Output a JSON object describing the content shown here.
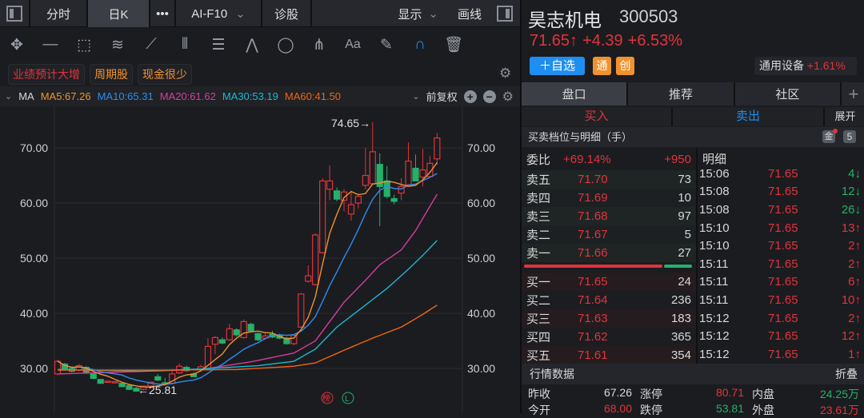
{
  "toolbar": {
    "tabs": [
      "分时",
      "日K",
      "•••",
      "AI-F10",
      "诊股"
    ],
    "display": "显示",
    "draw": "画线",
    "tools": [
      "move-icon",
      "line-icon",
      "rectangle-icon",
      "fan-icon",
      "segment-icon",
      "parallel-lines-icon",
      "fibonacci-icon",
      "wave-icon",
      "circle-icon",
      "pitchfork-icon",
      "text-icon",
      "eraser-icon",
      "magnet-icon",
      "trash-icon"
    ],
    "text_tool": "Aa"
  },
  "tags": [
    {
      "label": "业绩预计大增",
      "color": "#e0343b"
    },
    {
      "label": "周期股",
      "color": "#f0922e"
    },
    {
      "label": "现金很少",
      "color": "#f0922e"
    }
  ],
  "ma_bar": {
    "name": "MA",
    "items": [
      {
        "label": "MA5:67.26",
        "color": "#f0922e"
      },
      {
        "label": "MA10:65.31",
        "color": "#2d8cf0"
      },
      {
        "label": "MA20:61.62",
        "color": "#d63d9a"
      },
      {
        "label": "MA30:53.19",
        "color": "#1cb8cf"
      },
      {
        "label": "MA60:41.50",
        "color": "#f06414"
      }
    ],
    "adjust": "前复权"
  },
  "chart_data": {
    "type": "candlestick",
    "ylim": [
      24,
      76
    ],
    "yticks": [
      "70.00",
      "60.00",
      "50.00",
      "40.00",
      "30.00"
    ],
    "high_label": "74.65→",
    "low_label": "←25.81",
    "candles": [
      [
        29.0,
        31.6,
        28.8,
        31.3
      ],
      [
        30.8,
        31.0,
        29.6,
        29.8
      ],
      [
        30.0,
        30.3,
        29.3,
        29.5
      ],
      [
        29.7,
        30.8,
        29.5,
        30.5
      ],
      [
        30.2,
        30.4,
        29.0,
        29.3
      ],
      [
        29.0,
        29.2,
        28.0,
        28.2
      ],
      [
        28.0,
        28.1,
        27.2,
        27.3
      ],
      [
        27.6,
        27.8,
        27.4,
        27.7
      ],
      [
        27.5,
        27.7,
        27.3,
        27.6
      ],
      [
        27.3,
        27.4,
        26.6,
        26.7
      ],
      [
        26.9,
        27.0,
        26.1,
        26.2
      ],
      [
        26.4,
        26.6,
        25.81,
        25.9
      ],
      [
        26.2,
        26.9,
        26.0,
        26.8
      ],
      [
        26.8,
        27.6,
        26.6,
        27.5
      ],
      [
        28.5,
        29.0,
        27.7,
        27.9
      ],
      [
        27.4,
        28.3,
        27.2,
        27.3
      ],
      [
        27.3,
        29.8,
        27.1,
        29.0
      ],
      [
        29.2,
        30.9,
        29.0,
        30.4
      ],
      [
        30.2,
        30.5,
        29.4,
        29.6
      ],
      [
        29.0,
        29.3,
        28.4,
        28.5
      ],
      [
        29.8,
        30.7,
        29.6,
        30.3
      ],
      [
        30.0,
        35.5,
        29.8,
        34.0
      ],
      [
        34.4,
        35.9,
        32.6,
        35.6
      ],
      [
        35.2,
        35.6,
        34.4,
        34.6
      ],
      [
        35.2,
        38.1,
        35.0,
        37.2
      ],
      [
        37.0,
        37.3,
        35.8,
        36.1
      ],
      [
        35.6,
        38.9,
        35.4,
        38.5
      ],
      [
        38.0,
        38.3,
        36.6,
        36.8
      ],
      [
        36.3,
        36.5,
        35.0,
        35.2
      ],
      [
        35.5,
        36.6,
        35.2,
        35.9
      ],
      [
        36.2,
        36.8,
        35.5,
        35.7
      ],
      [
        36.0,
        36.3,
        35.3,
        35.5
      ],
      [
        35.5,
        35.7,
        34.3,
        34.5
      ],
      [
        34.5,
        36.3,
        34.2,
        36.0
      ],
      [
        37.5,
        43.5,
        37.4,
        43.5
      ],
      [
        45.8,
        48.7,
        45.6,
        46.8
      ],
      [
        45.2,
        54.5,
        45.0,
        54.2
      ],
      [
        51.0,
        64.5,
        50.8,
        64.0
      ],
      [
        62.5,
        66.8,
        60.5,
        64.0
      ],
      [
        62.2,
        62.8,
        60.3,
        60.7
      ],
      [
        60.5,
        62.5,
        58.5,
        62.0
      ],
      [
        58.0,
        62.2,
        56.8,
        59.7
      ],
      [
        60.0,
        61.6,
        59.0,
        61.2
      ],
      [
        63.2,
        70.0,
        62.5,
        65.0
      ],
      [
        63.5,
        74.65,
        63.3,
        69.3
      ],
      [
        67.0,
        69.0,
        55.8,
        63.0
      ],
      [
        64.0,
        66.7,
        60.8,
        61.2
      ],
      [
        60.8,
        61.5,
        59.8,
        60.3
      ],
      [
        61.8,
        64.5,
        60.5,
        63.0
      ],
      [
        63.3,
        71.0,
        63.0,
        67.6
      ],
      [
        66.3,
        68.8,
        64.0,
        64.0
      ],
      [
        64.7,
        69.8,
        63.0,
        66.0
      ],
      [
        64.8,
        68.5,
        64.6,
        67.2
      ],
      [
        68.0,
        72.7,
        67.0,
        71.8
      ]
    ],
    "ma_series": [
      {
        "name": "MA20",
        "color": "#d63d9a",
        "points": [
          [
            0,
            29.0
          ],
          [
            10,
            29.4
          ],
          [
            20,
            29.8
          ],
          [
            27,
            31.2
          ],
          [
            33,
            32.8
          ],
          [
            36,
            35.0
          ],
          [
            38,
            38.5
          ],
          [
            40,
            42.0
          ],
          [
            43,
            46.0
          ],
          [
            45,
            48.8
          ],
          [
            48,
            51.5
          ],
          [
            50,
            55.0
          ],
          [
            53,
            61.6
          ]
        ]
      },
      {
        "name": "MA30",
        "color": "#1cb8cf",
        "points": [
          [
            0,
            29.8
          ],
          [
            12,
            29.5
          ],
          [
            20,
            29.9
          ],
          [
            28,
            30.5
          ],
          [
            33,
            31.3
          ],
          [
            36,
            33.5
          ],
          [
            39,
            37.5
          ],
          [
            43,
            41.5
          ],
          [
            46,
            44.5
          ],
          [
            49,
            48.0
          ],
          [
            51,
            50.5
          ],
          [
            53,
            53.2
          ]
        ]
      },
      {
        "name": "MA60",
        "color": "#f06414",
        "points": [
          [
            0,
            29.7
          ],
          [
            15,
            29.7
          ],
          [
            25,
            29.8
          ],
          [
            33,
            30.4
          ],
          [
            36,
            31.0
          ],
          [
            40,
            33.3
          ],
          [
            44,
            35.5
          ],
          [
            48,
            37.5
          ],
          [
            51,
            39.8
          ],
          [
            53,
            41.5
          ]
        ]
      }
    ],
    "ma5_color": "#f0922e",
    "ma10_color": "#2d8cf0",
    "up_color": "#e0343b",
    "down_color": "#25b06a",
    "markers": [
      "榜",
      "L"
    ]
  },
  "stock": {
    "name": "昊志机电",
    "code": "300503",
    "price": "71.65↑",
    "change": "+4.39",
    "pct": "+6.53%",
    "watch_btn": "＋自选",
    "badges": [
      "通",
      "创"
    ],
    "sector": "通用设备",
    "sector_pct": "+1.61%"
  },
  "tabs": [
    "盘口",
    "推荐",
    "社区"
  ],
  "trade": {
    "buy": "买入",
    "sell": "卖出",
    "expand": "展开"
  },
  "book": {
    "title": "买卖档位与明细（手）",
    "level": "5",
    "ratio_label": "委比",
    "ratio": "+69.14%",
    "diff": "+950",
    "detail_label": "明细",
    "asks": [
      [
        "卖五",
        "71.70",
        "73"
      ],
      [
        "卖四",
        "71.69",
        "10"
      ],
      [
        "卖三",
        "71.68",
        "97"
      ],
      [
        "卖二",
        "71.67",
        "5"
      ],
      [
        "卖一",
        "71.66",
        "27"
      ]
    ],
    "bids": [
      [
        "买一",
        "71.65",
        "24"
      ],
      [
        "买二",
        "71.64",
        "236"
      ],
      [
        "买三",
        "71.63",
        "183"
      ],
      [
        "买四",
        "71.62",
        "365"
      ],
      [
        "买五",
        "71.61",
        "354"
      ]
    ],
    "buy_ratio": 0.83
  },
  "ticks": [
    [
      "15:06",
      "71.65",
      "4↓",
      "down"
    ],
    [
      "15:08",
      "71.65",
      "12↓",
      "down"
    ],
    [
      "15:08",
      "71.65",
      "26↓",
      "down"
    ],
    [
      "15:10",
      "71.65",
      "13↑",
      "up"
    ],
    [
      "15:10",
      "71.65",
      "2↑",
      "up"
    ],
    [
      "15:11",
      "71.65",
      "2↑",
      "up"
    ],
    [
      "15:11",
      "71.65",
      "6↑",
      "up"
    ],
    [
      "15:11",
      "71.65",
      "10↑",
      "up"
    ],
    [
      "15:12",
      "71.65",
      "2↑",
      "up"
    ],
    [
      "15:12",
      "71.65",
      "12↑",
      "up"
    ],
    [
      "15:12",
      "71.65",
      "1↑",
      "up"
    ]
  ],
  "quote": {
    "title": "行情数据",
    "fold": "折叠",
    "rows": [
      [
        [
          "昨收",
          "67.26",
          ""
        ],
        [
          "涨停",
          "80.71",
          "red"
        ],
        [
          "内盘",
          "24.25万",
          "green"
        ]
      ],
      [
        [
          "今开",
          "68.00",
          "red"
        ],
        [
          "跌停",
          "53.81",
          "green"
        ],
        [
          "外盘",
          "23.61万",
          "red"
        ]
      ]
    ]
  }
}
